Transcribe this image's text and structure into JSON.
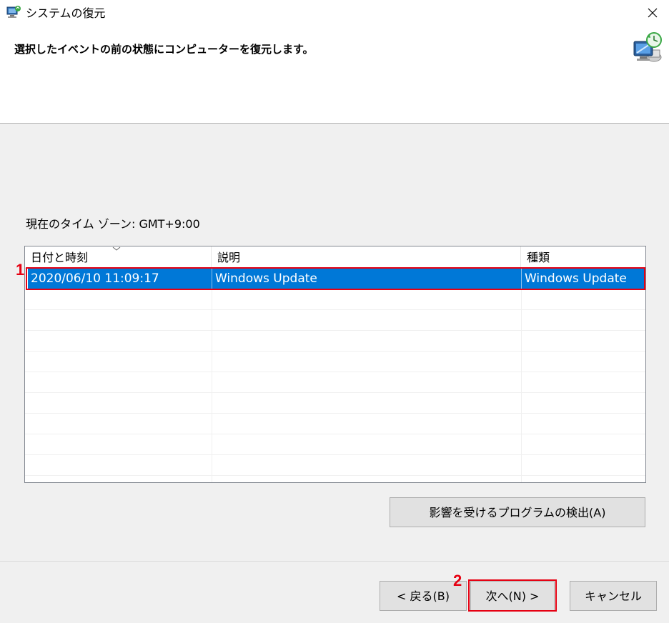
{
  "window": {
    "title": "システムの復元",
    "icons": {
      "app": "system-restore-icon",
      "close": "close-icon",
      "header": "restore-computer-icon"
    }
  },
  "header": {
    "heading": "選択したイベントの前の状態にコンピューターを復元します。"
  },
  "main": {
    "timezone_label": "現在のタイム ゾーン: GMT+9:00",
    "table": {
      "columns": [
        "日付と時刻",
        "説明",
        "種類"
      ],
      "sort_indicator": "chevron-down-icon",
      "rows": [
        {
          "date": "2020/06/10 11:09:17",
          "description": "Windows Update",
          "type": "Windows Update",
          "selected": true
        }
      ]
    },
    "scan_button_label": "影響を受けるプログラムの検出(A)"
  },
  "footer": {
    "back_label": "< 戻る(B)",
    "next_label": "次へ(N) >",
    "cancel_label": "キャンセル"
  },
  "annotations": {
    "callout_1": "1",
    "callout_2": "2"
  },
  "colors": {
    "selection": "#0078d7",
    "annotation": "#e60012",
    "dialog_background": "#f0f0f0"
  }
}
